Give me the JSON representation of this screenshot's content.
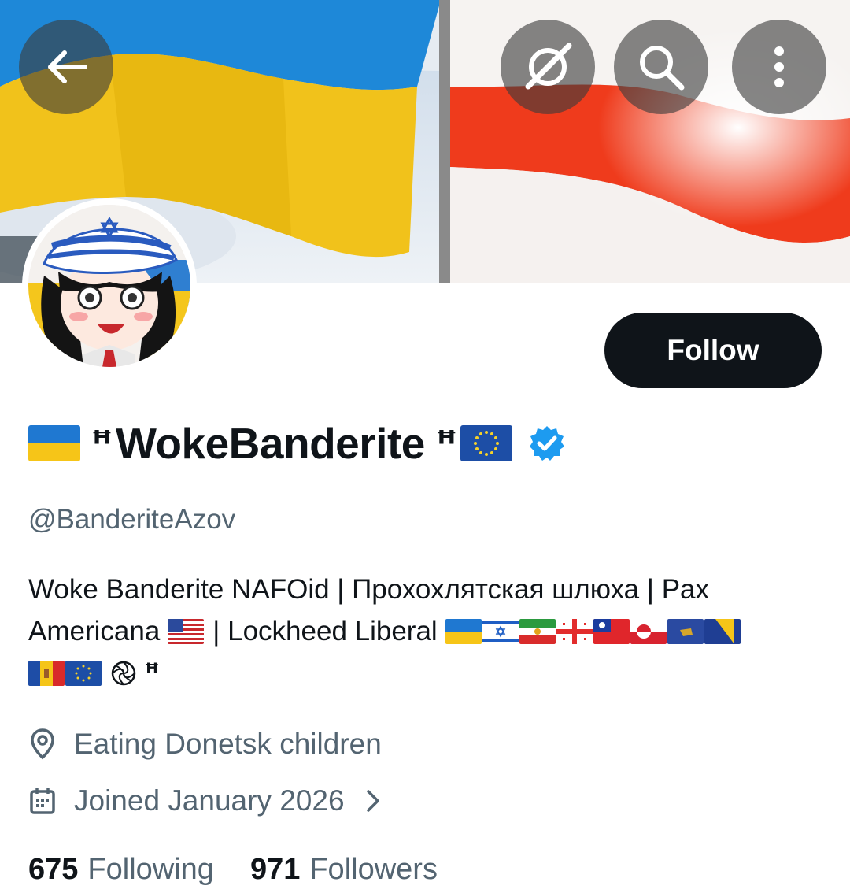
{
  "header": {
    "back_icon": "arrow-left-icon",
    "grok_icon": "grok-icon",
    "search_icon": "search-icon",
    "more_icon": "more-vertical-icon"
  },
  "profile": {
    "display_name": "WokeBanderite",
    "nafo_symbol": "ꟸ",
    "handle": "@BanderiteAzov",
    "follow_label": "Follow",
    "verified": true
  },
  "bio": {
    "line1": "Woke Banderite NAFOid | Прохохлятская шлюха | Pax",
    "line2": "Americana",
    "line2b": "| Lockheed Liberal",
    "line3_nafo": "ꟸ"
  },
  "meta": {
    "location": "Eating Donetsk children",
    "joined": "Joined January 2026"
  },
  "stats": {
    "following_count": "675",
    "following_label": "Following",
    "followers_count": "971",
    "followers_label": "Followers"
  },
  "colors": {
    "text": "#0f1419",
    "muted": "#536471",
    "verified": "#1d9bf0",
    "follow_bg": "#0f1419"
  }
}
